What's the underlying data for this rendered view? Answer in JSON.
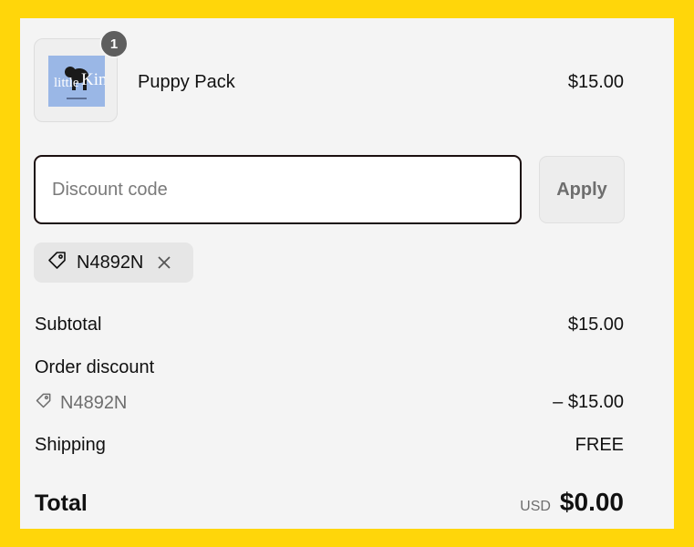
{
  "colors": {
    "background": "#FFD60A",
    "panel": "#F4F4F4",
    "input_border": "#1B0F0F",
    "badge": "#5E5E5E",
    "muted_text": "#6E6E6E"
  },
  "cart": {
    "item": {
      "image_icon": "product-thumbnail",
      "quantity": "1",
      "name": "Puppy Pack",
      "price": "$15.00"
    }
  },
  "discount": {
    "placeholder": "Discount code",
    "value": "",
    "apply_label": "Apply",
    "applied_code": "N4892N",
    "tag_icon": "tag-icon",
    "remove_icon": "close-icon"
  },
  "summary": {
    "subtotal_label": "Subtotal",
    "subtotal_value": "$15.00",
    "order_discount_label": "Order discount",
    "order_discount_code": "N4892N",
    "order_discount_value": "– $15.00",
    "shipping_label": "Shipping",
    "shipping_value": "FREE",
    "total_label": "Total",
    "total_currency": "USD",
    "total_value": "$0.00"
  }
}
